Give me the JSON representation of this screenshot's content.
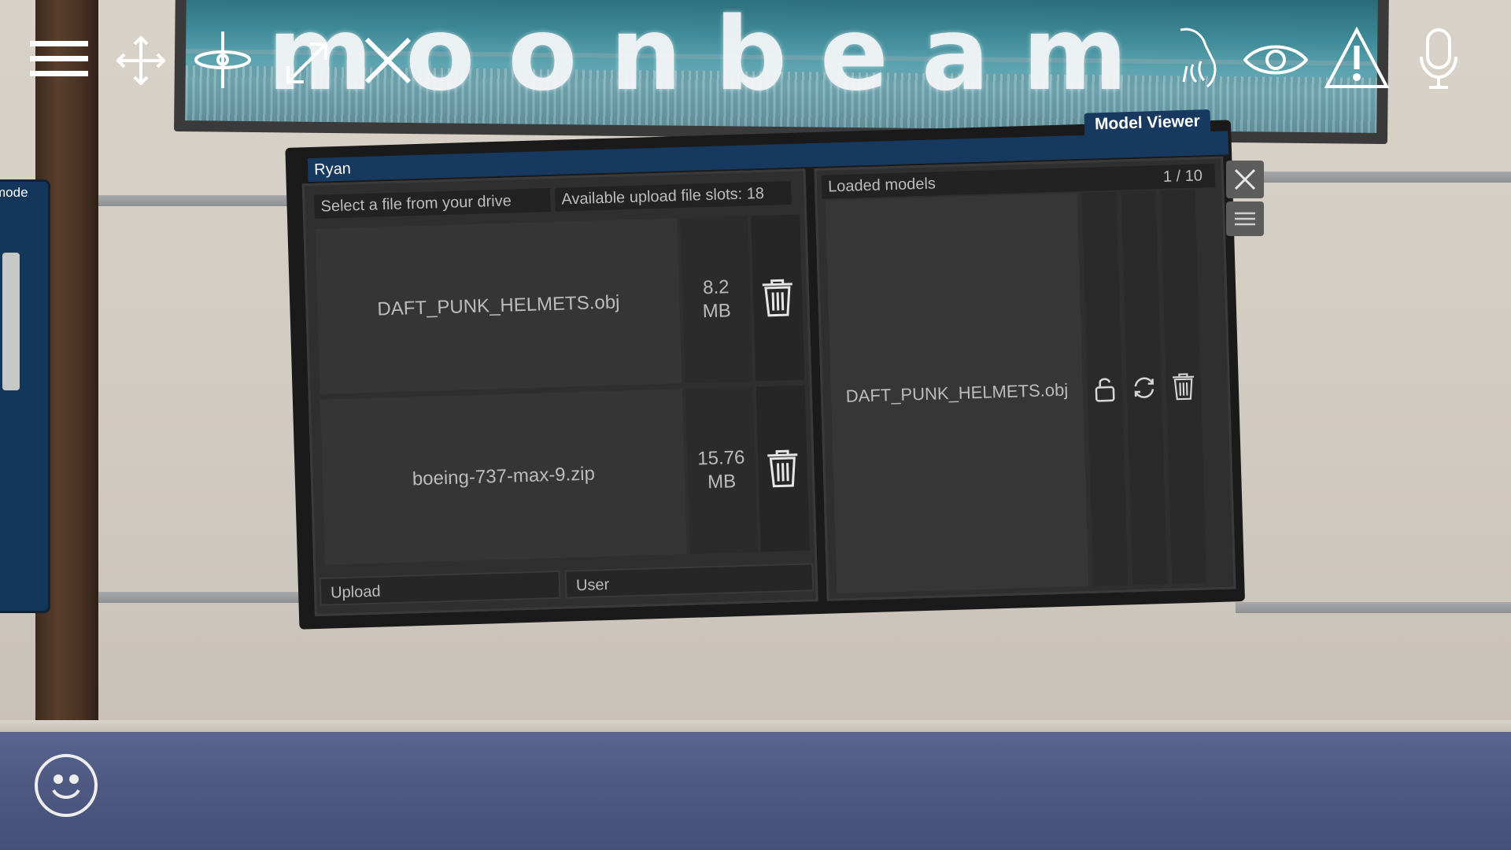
{
  "billboard": {
    "brand": "moonbeam"
  },
  "left_panel": {
    "mode_label": "mode"
  },
  "toolbar": {
    "icons": [
      "menu-icon",
      "move-icon",
      "orbit-icon",
      "resize-icon",
      "close-icon",
      "hand-icon",
      "eye-icon",
      "warning-icon",
      "microphone-icon"
    ]
  },
  "panel": {
    "owner": "Ryan",
    "title": "Model Viewer",
    "select_file": "Select a file from your drive",
    "slots": "Available upload file slots: 18",
    "files": [
      {
        "name": "DAFT_PUNK_HELMETS.obj",
        "size_value": "8.2",
        "size_unit": "MB"
      },
      {
        "name": "boeing-737-max-9.zip",
        "size_value": "15.76",
        "size_unit": "MB"
      }
    ],
    "upload_label": "Upload",
    "user_label": "User",
    "loaded": {
      "title": "Loaded models",
      "count": "1 / 10",
      "name": "DAFT_PUNK_HELMETS.obj"
    }
  },
  "colors": {
    "title_bar": "#17395f",
    "panel_bg": "#2f2f2f",
    "text": "#bcbcbc",
    "floor": "#4e5a82"
  }
}
